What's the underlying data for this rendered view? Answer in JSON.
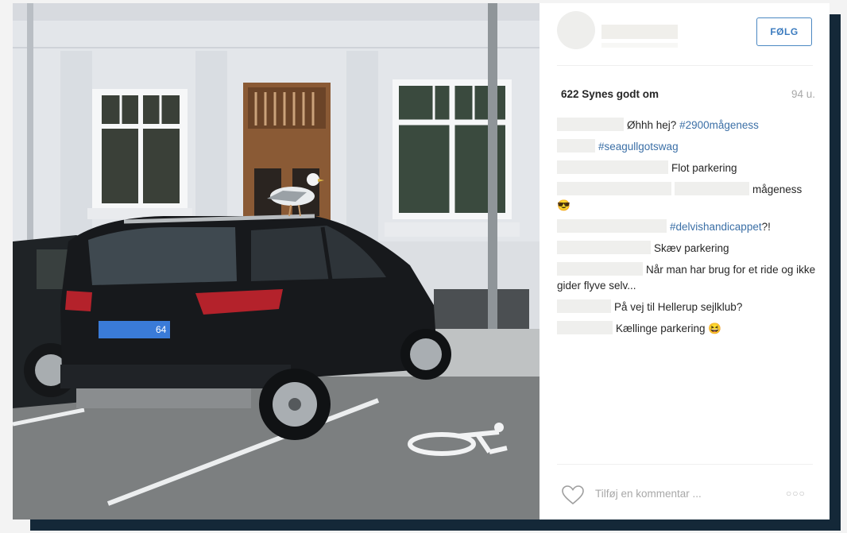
{
  "post": {
    "follow_label": "FØLG",
    "likes": "622 Synes godt om",
    "time": "94 u.",
    "comments": [
      {
        "before": "",
        "text": "Øhhh hej?",
        "tag": "#2900mågeness",
        "after": ""
      },
      {
        "before": "",
        "text": "",
        "tag": "#seagullgotswag",
        "after": ""
      },
      {
        "before": "",
        "text": "Flot parkering",
        "tag": "",
        "after": ""
      },
      {
        "before": "",
        "text": "mågeness",
        "tag": "",
        "after": "😎"
      },
      {
        "before": "",
        "text": "",
        "tag": "#delvishandicappet",
        "after": "?!"
      },
      {
        "before": "",
        "text": "Skæv parkering",
        "tag": "",
        "after": ""
      },
      {
        "before": "",
        "text": "Når man har brug for et ride og ikke gider flyve selv...",
        "tag": "",
        "after": ""
      },
      {
        "before": "",
        "text": "På vej til Hellerup sejlklub?",
        "tag": "",
        "after": ""
      },
      {
        "before": "",
        "text": "Kællinge parkering 😆",
        "tag": "",
        "after": ""
      }
    ],
    "add_comment_placeholder": "Tilføj en kommentar ...",
    "more_label": "○○○",
    "license_plate_suffix": "64"
  },
  "colors": {
    "accent": "#3b7bbf",
    "backdrop": "#142838",
    "hashtag": "#3b6fa6",
    "muted": "#a8a8a8"
  },
  "icons": {
    "like": "heart-icon",
    "more": "more-options-icon",
    "disabled_parking": "wheelchair-icon"
  }
}
